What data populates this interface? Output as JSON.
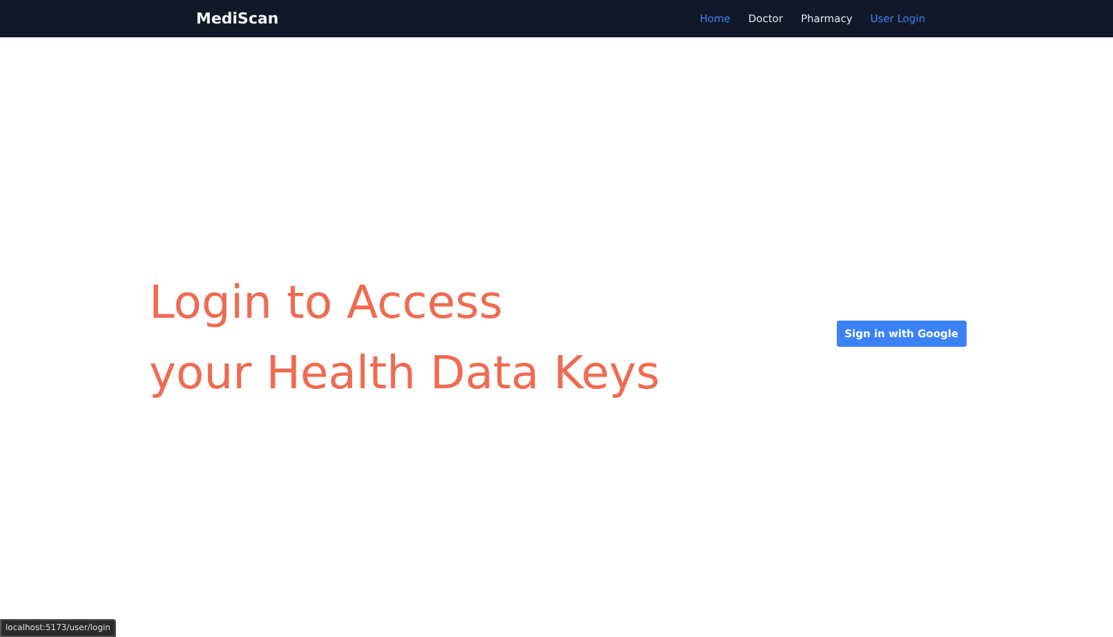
{
  "navbar": {
    "brand": "MediScan",
    "links": [
      {
        "label": "Home",
        "highlighted": true
      },
      {
        "label": "Doctor",
        "highlighted": false
      },
      {
        "label": "Pharmacy",
        "highlighted": false
      },
      {
        "label": "User Login",
        "highlighted": true
      }
    ]
  },
  "hero": {
    "heading_lines": [
      "Login to Access",
      "your Health Data Keys"
    ],
    "button": "Sign in with Google"
  },
  "status_url": "localhost:5173/user/login"
}
